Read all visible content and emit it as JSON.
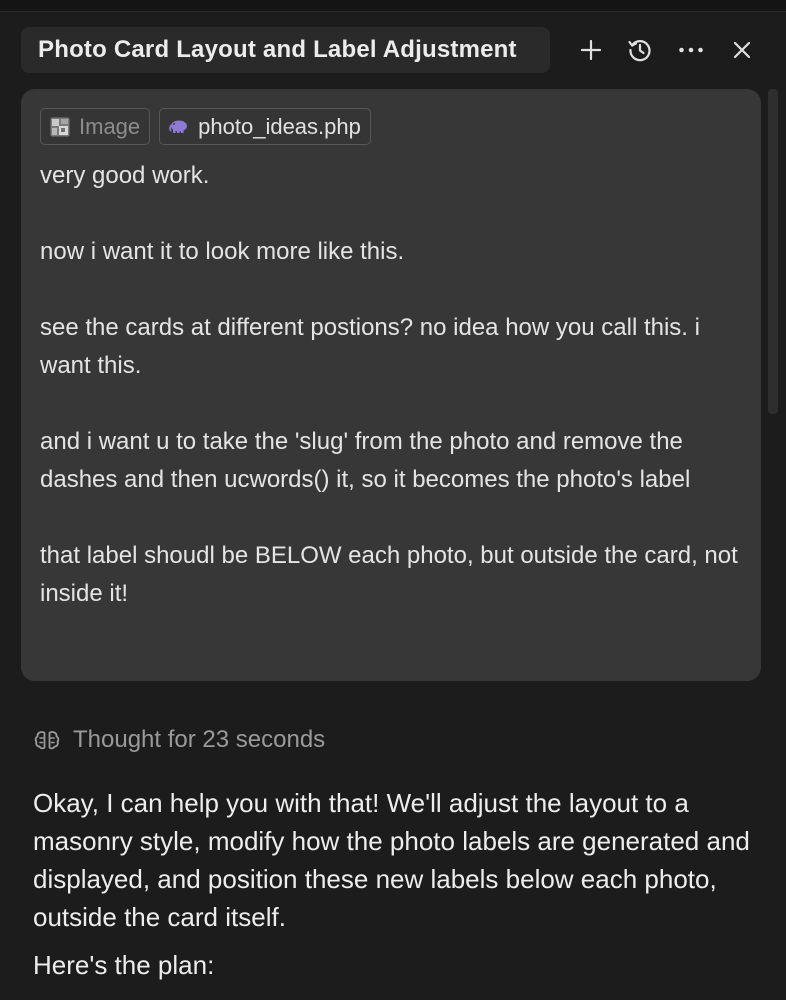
{
  "header": {
    "title": "Photo Card Layout and Label Adjustment",
    "actions": [
      {
        "name": "new-chat-button",
        "icon": "plus-icon"
      },
      {
        "name": "history-button",
        "icon": "history-icon"
      },
      {
        "name": "more-button",
        "icon": "ellipsis-icon"
      },
      {
        "name": "close-button",
        "icon": "close-icon"
      }
    ]
  },
  "message": {
    "attachments": [
      {
        "label": "Image",
        "icon": "image-icon"
      },
      {
        "label": "photo_ideas.php",
        "icon": "php-elephant-icon"
      }
    ],
    "paragraphs": [
      "very good work.",
      "now i want it to look more like this.",
      "see the cards at different postions? no idea how you call this. i want this.",
      "and i want u to take the 'slug' from the photo and remove the dashes and then ucwords() it, so it becomes the photo's label",
      "that label shoudl be BELOW each photo, but outside the card, not inside it!"
    ]
  },
  "thought": {
    "label": "Thought for 23 seconds",
    "icon": "brain-icon"
  },
  "response": {
    "paragraphs": [
      "Okay, I can help you with that! We'll adjust the layout to a masonry style, modify how the photo labels are generated and displayed, and position these new labels below each photo, outside the card itself.",
      "Here's the plan:"
    ]
  },
  "colors": {
    "background": "#1c1c1c",
    "card": "#373737",
    "title_chip": "#2a2a2a",
    "muted_text": "#9a9a9a",
    "php_accent": "#8c7ad6"
  }
}
